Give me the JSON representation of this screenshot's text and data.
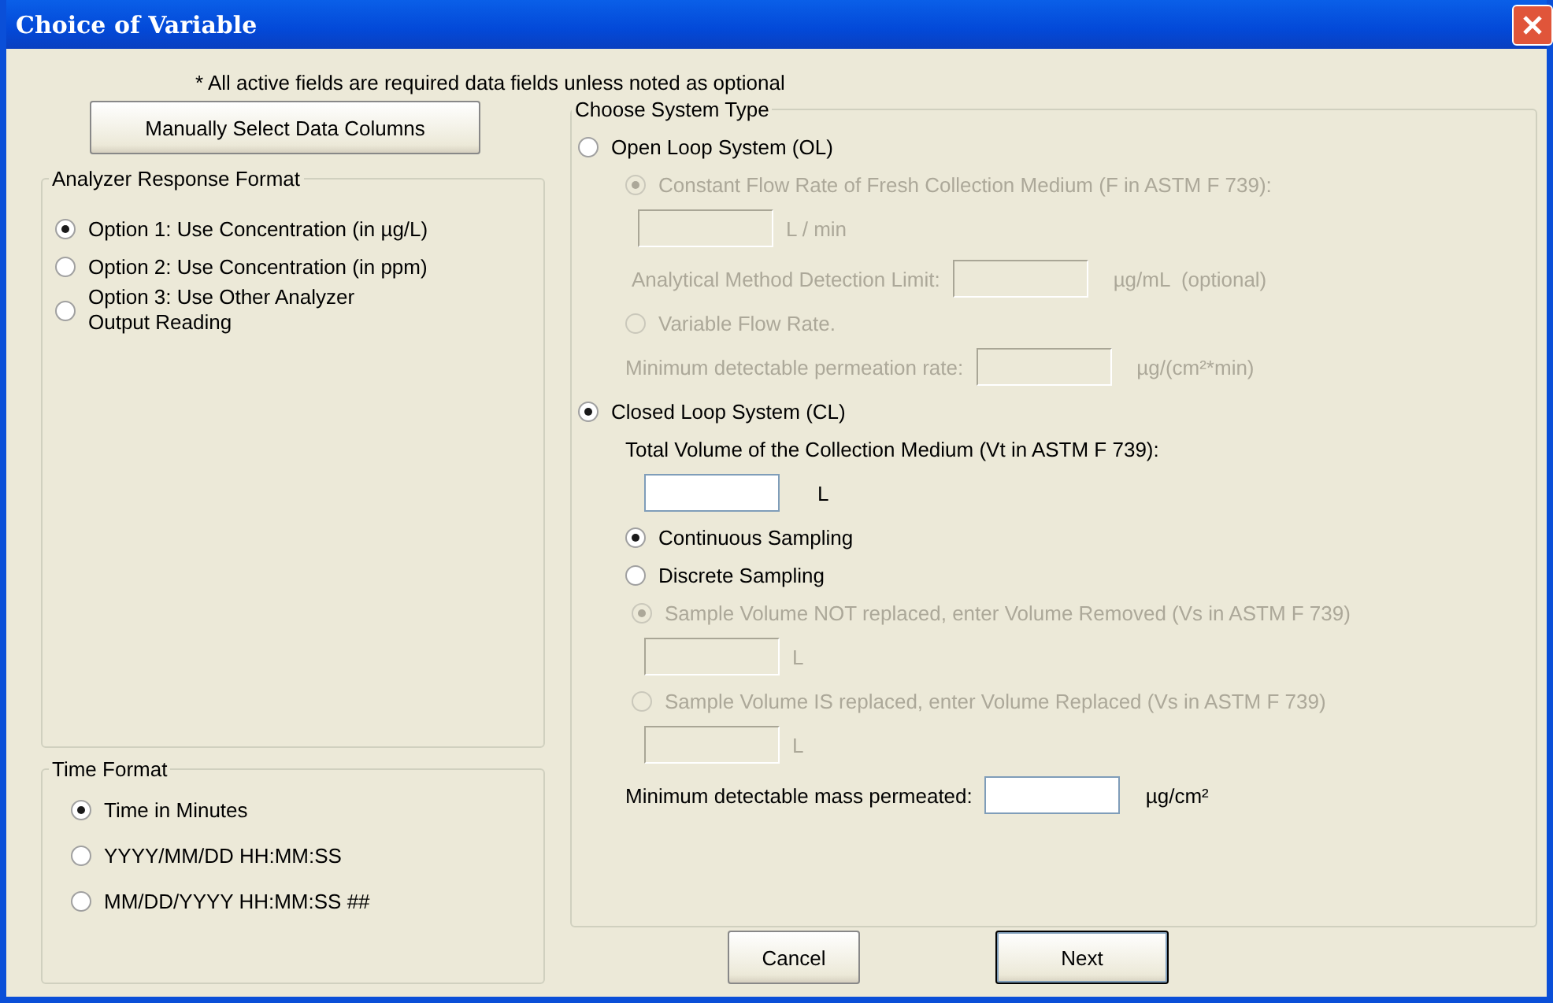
{
  "window": {
    "title": "Choice of Variable"
  },
  "note": "* All active fields are required data fields unless noted as optional",
  "manual_button": "Manually Select Data Columns",
  "analyzer_format": {
    "legend": "Analyzer Response Format",
    "options": [
      {
        "label": "Option 1: Use Concentration (in µg/L)",
        "selected": true
      },
      {
        "label": "Option 2: Use Concentration (in ppm)",
        "selected": false
      },
      {
        "label": "Option 3: Use Other Analyzer Output Reading",
        "selected": false
      }
    ]
  },
  "time_format": {
    "legend": "Time Format",
    "options": [
      {
        "label": "Time in Minutes",
        "selected": true
      },
      {
        "label": "YYYY/MM/DD HH:MM:SS",
        "selected": false
      },
      {
        "label": "MM/DD/YYYY HH:MM:SS ##",
        "selected": false
      }
    ]
  },
  "system_type": {
    "legend": "Choose System Type",
    "items": [
      {
        "kind": "radio",
        "label": "Open Loop System (OL)",
        "selected": false,
        "disabled": false,
        "children": [
          {
            "kind": "radio",
            "label": "Constant Flow Rate of Fresh Collection Medium (F in ASTM F 739):",
            "selected": true,
            "disabled": true,
            "children": [
              {
                "kind": "field",
                "unit": "L / min",
                "disabled": true
              },
              {
                "kind": "labeled_field",
                "label": "Analytical Method Detection Limit:",
                "unit": "µg/mL  (optional)",
                "disabled": true
              }
            ]
          },
          {
            "kind": "radio",
            "label": "Variable Flow Rate.",
            "selected": false,
            "disabled": true
          },
          {
            "kind": "labeled_field",
            "label": "Minimum detectable permeation rate:",
            "unit": "µg/(cm²*min)",
            "disabled": true
          }
        ]
      },
      {
        "kind": "radio",
        "label": "Closed Loop System (CL)",
        "selected": true,
        "disabled": false,
        "children": [
          {
            "kind": "label",
            "label": "Total Volume of the Collection Medium (Vt in ASTM F 739):",
            "disabled": false
          },
          {
            "kind": "field",
            "unit": "L",
            "disabled": false
          },
          {
            "kind": "radio",
            "label": "Continuous Sampling",
            "selected": true,
            "disabled": false
          },
          {
            "kind": "radio",
            "label": "Discrete Sampling",
            "selected": false,
            "disabled": false,
            "children": [
              {
                "kind": "radio",
                "label": "Sample Volume NOT replaced, enter Volume Removed (Vs in ASTM F 739)",
                "selected": true,
                "disabled": true,
                "children": [
                  {
                    "kind": "field",
                    "unit": "L",
                    "disabled": true
                  }
                ]
              },
              {
                "kind": "radio",
                "label": "Sample Volume IS replaced, enter Volume Replaced (Vs in ASTM F 739)",
                "selected": false,
                "disabled": true,
                "children": [
                  {
                    "kind": "field",
                    "unit": "L",
                    "disabled": true
                  }
                ]
              }
            ]
          },
          {
            "kind": "labeled_field",
            "label": "Minimum detectable mass permeated:",
            "unit": "µg/cm²",
            "disabled": false
          }
        ]
      }
    ]
  },
  "buttons": [
    {
      "label": "Cancel",
      "default": false
    },
    {
      "label": "Next",
      "default": true
    }
  ]
}
